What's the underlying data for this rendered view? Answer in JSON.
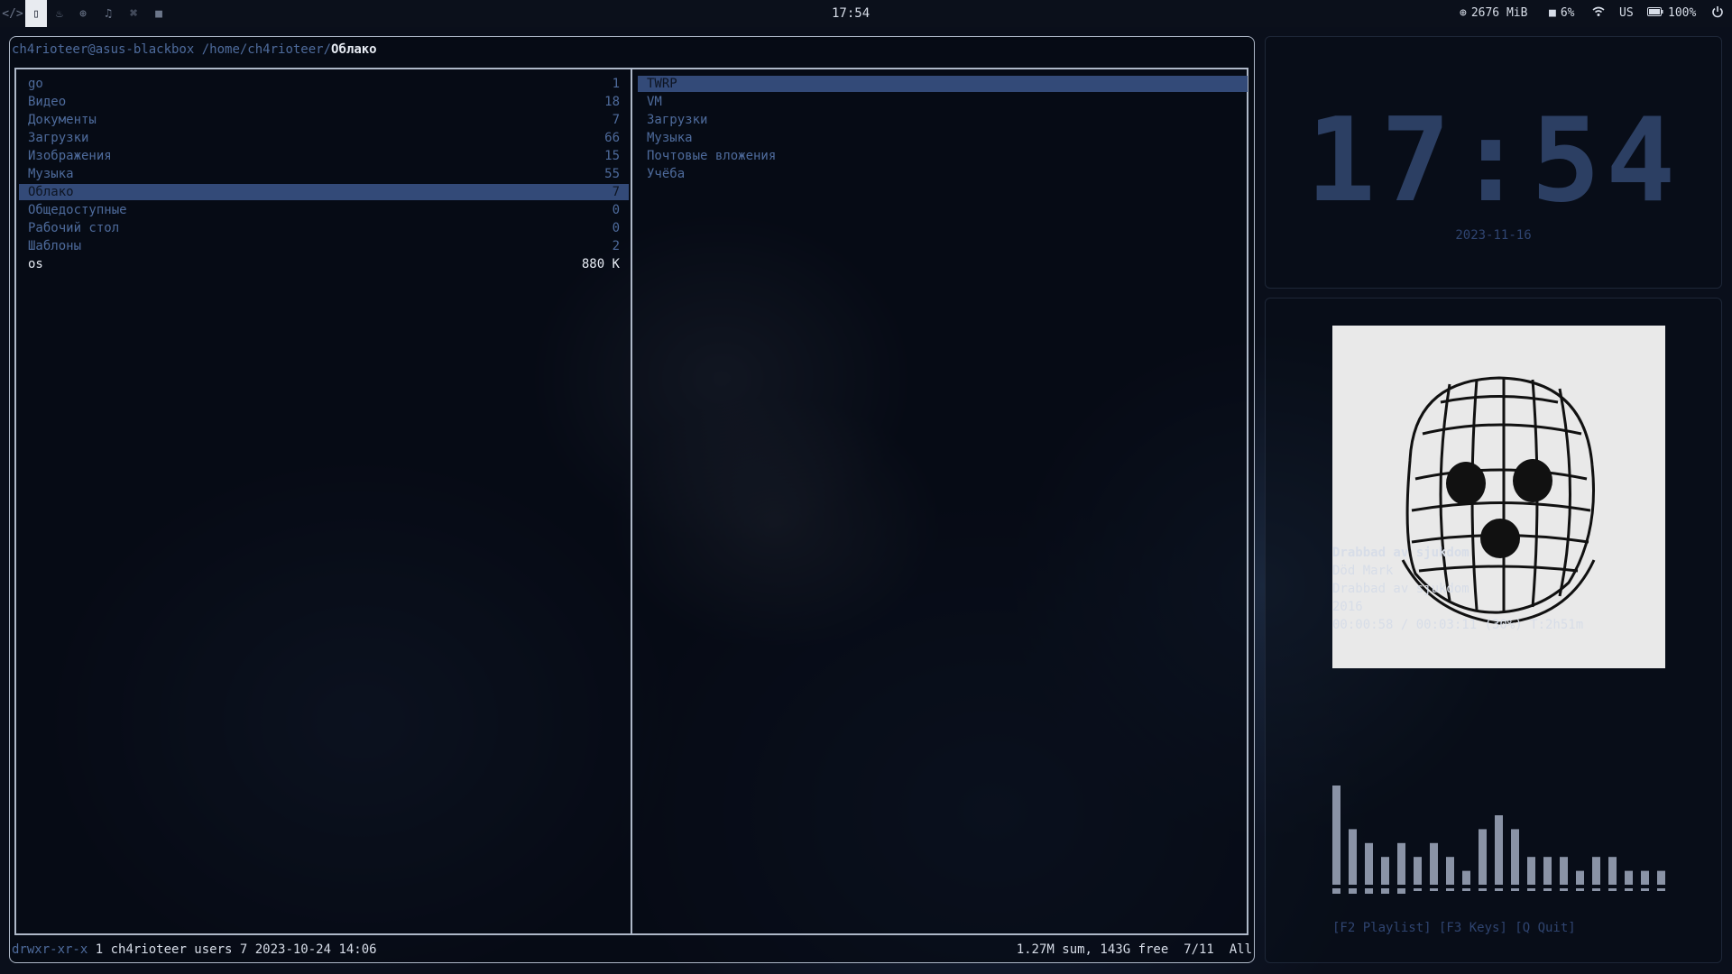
{
  "topbar": {
    "workspaces": [
      {
        "icon": "code-icon",
        "glyph": "</>"
      },
      {
        "icon": "file-icon",
        "glyph": "▯",
        "active": true
      },
      {
        "icon": "fire-icon",
        "glyph": "♨"
      },
      {
        "icon": "globe-icon",
        "glyph": "⊕"
      },
      {
        "icon": "headphones-icon",
        "glyph": "♫"
      },
      {
        "icon": "gamepad-icon",
        "glyph": "⌘"
      },
      {
        "icon": "video-icon",
        "glyph": "■"
      }
    ],
    "clock": "17:54",
    "memory": "2676 MiB",
    "cpu": "6%",
    "layout": "US",
    "battery": "100%"
  },
  "terminal": {
    "title_user": "ch4rioteer@asus-blackbox",
    "title_path": "/home/ch4rioteer/",
    "title_dir": "Облако",
    "left_pane": [
      {
        "name": "go",
        "count": "1"
      },
      {
        "name": "Видео",
        "count": "18"
      },
      {
        "name": "Документы",
        "count": "7"
      },
      {
        "name": "Загрузки",
        "count": "66"
      },
      {
        "name": "Изображения",
        "count": "15"
      },
      {
        "name": "Музыка",
        "count": "55"
      },
      {
        "name": "Облако",
        "count": "7",
        "selected": true
      },
      {
        "name": "Общедоступные",
        "count": "0"
      },
      {
        "name": "Рабочий стол",
        "count": "0"
      },
      {
        "name": "Шаблоны",
        "count": "2"
      },
      {
        "name": "os",
        "count": "880 K",
        "file": true
      }
    ],
    "right_pane": [
      {
        "name": "TWRP",
        "selected": true
      },
      {
        "name": "VM"
      },
      {
        "name": "Загрузки"
      },
      {
        "name": "Музыка"
      },
      {
        "name": "Почтовые вложения"
      },
      {
        "name": "Учёба"
      }
    ],
    "status_perm": "drwxr-xr-x",
    "status_info": " 1 ch4rioteer users 7 2023-10-24 14:06",
    "status_right": "1.27M sum, 143G free  7/11  All"
  },
  "clock_widget": {
    "time": "17:54",
    "date": "2023-11-16"
  },
  "music": {
    "title": "Drabbad av sjukdom",
    "artist": "Död Mark",
    "album": "Drabbad av sjukdom",
    "year": "2016",
    "progress": "00:00:58 / 00:03:11 (30%) T:2h51m",
    "progress_fraction": 0.3,
    "keys": "[F2 Playlist] [F3 Keys] [Q Quit]",
    "visualizer_levels": [
      1.0,
      0.56,
      0.42,
      0.28,
      0.42,
      0.28,
      0.42,
      0.28,
      0.14,
      0.56,
      0.7,
      0.56,
      0.28,
      0.28,
      0.28,
      0.14,
      0.28,
      0.28,
      0.14,
      0.14,
      0.14
    ],
    "bar_color": "#8a93a6"
  }
}
